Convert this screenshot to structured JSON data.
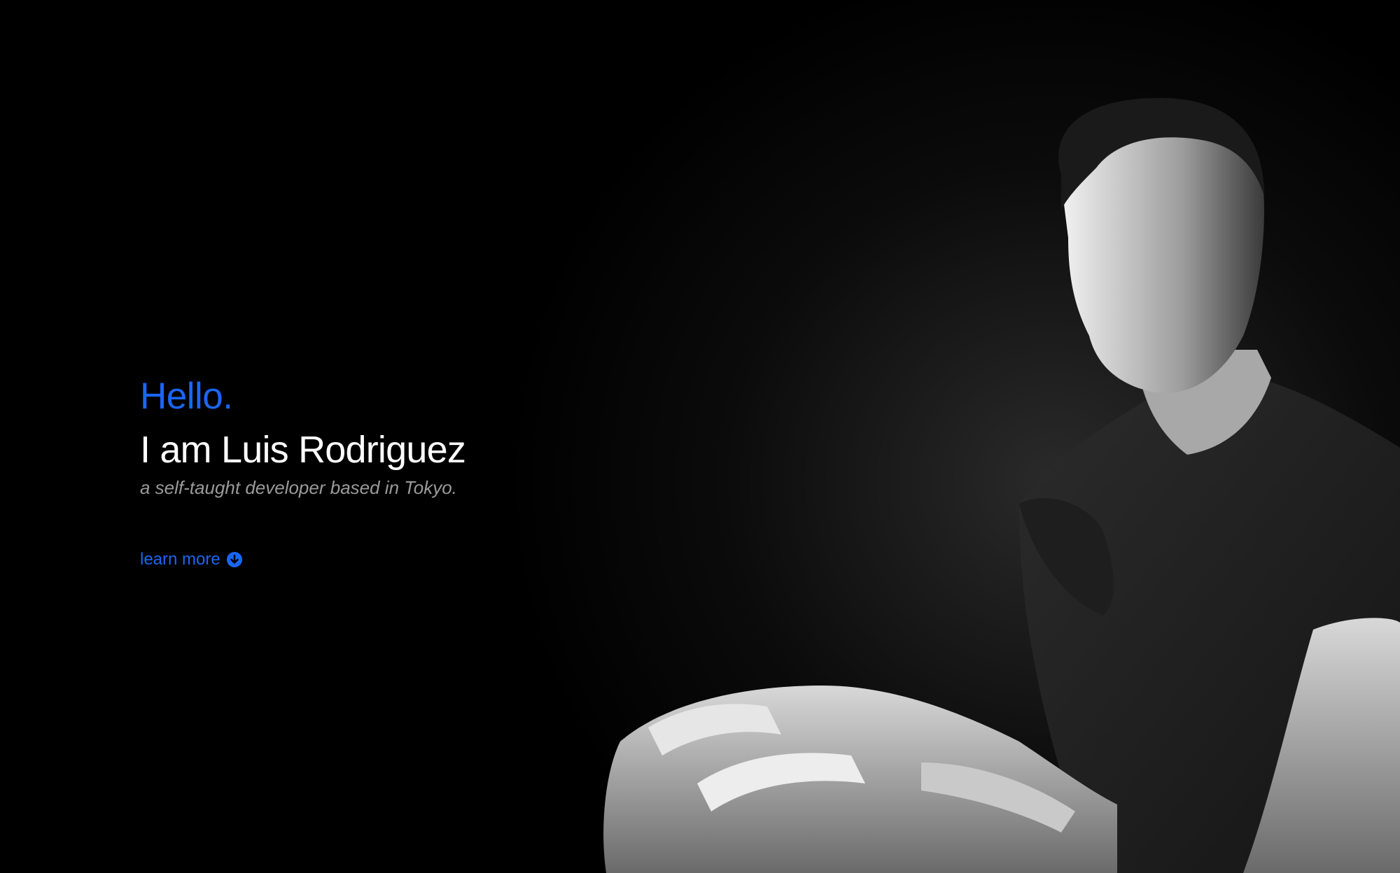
{
  "hero": {
    "greeting": "Hello.",
    "name": "I am Luis Rodriguez",
    "tagline": "a self-taught developer based in Tokyo.",
    "cta_label": "learn more",
    "cta_icon": "arrow-down-circle-icon"
  },
  "photo": {
    "subject": "portrait-photo"
  },
  "colors": {
    "background": "#000000",
    "accent": "#1a66f5",
    "name_text": "#ffffff",
    "tagline_text": "#9a9a9a"
  }
}
